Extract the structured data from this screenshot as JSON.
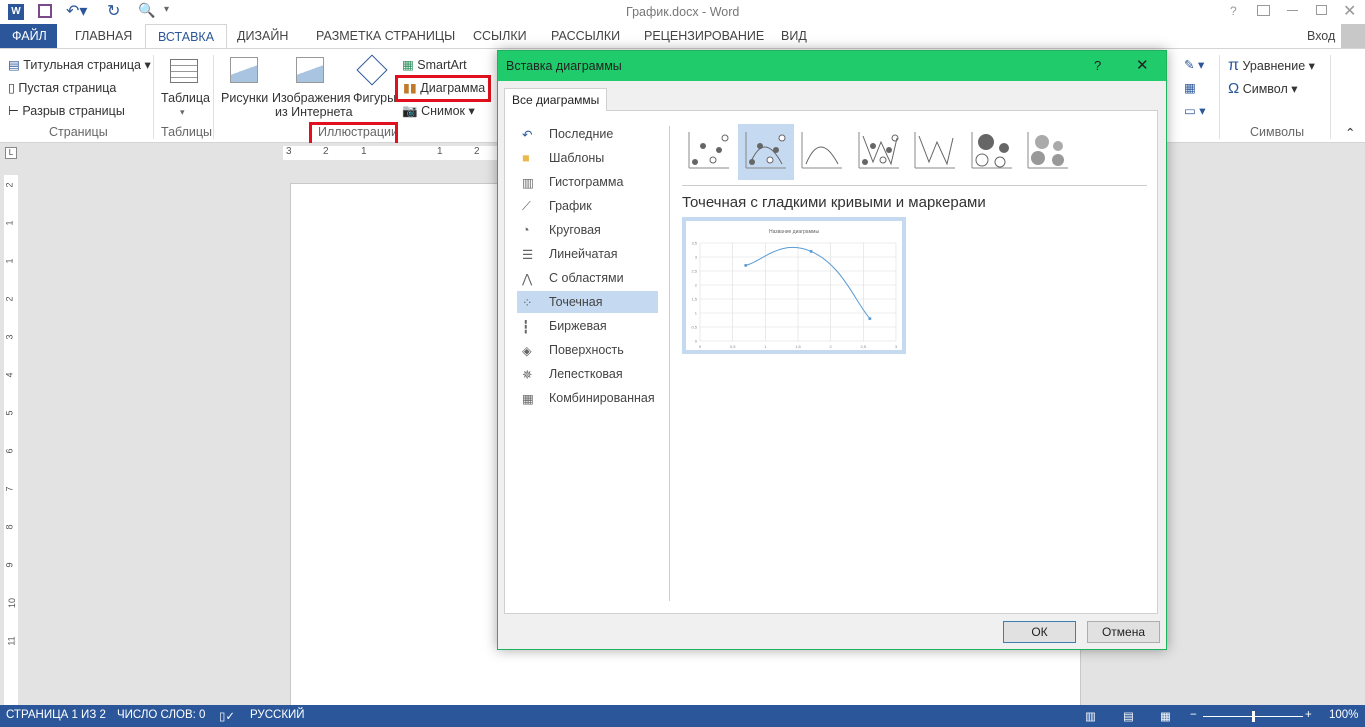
{
  "window": {
    "title": "График.docx - Word",
    "help": "?",
    "signin": "Вход"
  },
  "tabs": [
    "ФАЙЛ",
    "ГЛАВНАЯ",
    "ВСТАВКА",
    "ДИЗАЙН",
    "РАЗМЕТКА СТРАНИЦЫ",
    "ССЫЛКИ",
    "РАССЫЛКИ",
    "РЕЦЕНЗИРОВАНИЕ",
    "ВИД"
  ],
  "ribbon": {
    "pages": {
      "cover": "Титульная страница",
      "blank": "Пустая страница",
      "break": "Разрыв страницы",
      "group": "Страницы"
    },
    "tables": {
      "table": "Таблица",
      "group": "Таблицы"
    },
    "illustrations": {
      "pictures": "Рисунки",
      "online1": "Изображения",
      "online2": "из Интернета",
      "shapes": "Фигуры",
      "smartart": "SmartArt",
      "chart": "Диаграмма",
      "screenshot": "Снимок",
      "group": "Иллюстрации"
    },
    "symbols": {
      "equation": "Уравнение",
      "symbol": "Символ",
      "group": "Символы"
    }
  },
  "ruler": [
    "3",
    "2",
    "1",
    "1",
    "2"
  ],
  "vruler": [
    "2",
    "1",
    "1",
    "2",
    "3",
    "4",
    "5",
    "6",
    "7",
    "8",
    "9",
    "10",
    "11"
  ],
  "dialog": {
    "title": "Вставка диаграммы",
    "help": "?",
    "tab": "Все диаграммы",
    "types": [
      {
        "label": "Последние",
        "icon": "recent-icon"
      },
      {
        "label": "Шаблоны",
        "icon": "folder-icon"
      },
      {
        "label": "Гистограмма",
        "icon": "column-chart-icon"
      },
      {
        "label": "График",
        "icon": "line-chart-icon"
      },
      {
        "label": "Круговая",
        "icon": "pie-chart-icon"
      },
      {
        "label": "Линейчатая",
        "icon": "bar-chart-icon"
      },
      {
        "label": "С областями",
        "icon": "area-chart-icon"
      },
      {
        "label": "Точечная",
        "icon": "scatter-chart-icon"
      },
      {
        "label": "Биржевая",
        "icon": "stock-chart-icon"
      },
      {
        "label": "Поверхность",
        "icon": "surface-chart-icon"
      },
      {
        "label": "Лепестковая",
        "icon": "radar-chart-icon"
      },
      {
        "label": "Комбинированная",
        "icon": "combo-chart-icon"
      }
    ],
    "selected_type": "Точечная",
    "subtype_title": "Точечная с гладкими кривыми и маркерами",
    "ok": "ОК",
    "cancel": "Отмена"
  },
  "chart_data": {
    "type": "scatter",
    "title": "Название диаграммы",
    "x": [
      0.7,
      1.7,
      2.6
    ],
    "y": [
      2.7,
      3.2,
      0.8
    ],
    "xlim": [
      0,
      3
    ],
    "ylim": [
      0,
      3.5
    ],
    "xticks": [
      "0",
      "0,5",
      "1",
      "1,5",
      "2",
      "2,5",
      "3"
    ],
    "yticks": [
      "0",
      "0,5",
      "1",
      "1,5",
      "2",
      "2,5",
      "3",
      "3,5"
    ],
    "smooth": true,
    "markers": true
  },
  "status": {
    "page": "СТРАНИЦА 1 ИЗ 2",
    "words": "ЧИСЛО СЛОВ: 0",
    "lang": "РУССКИЙ",
    "zoom": "100%",
    "zoom_fraction": 0.5
  },
  "colors": {
    "accent": "#2b579a",
    "dialog": "#1fcb6a",
    "highlight": "#e0101e",
    "selection": "#c5d9f1"
  }
}
